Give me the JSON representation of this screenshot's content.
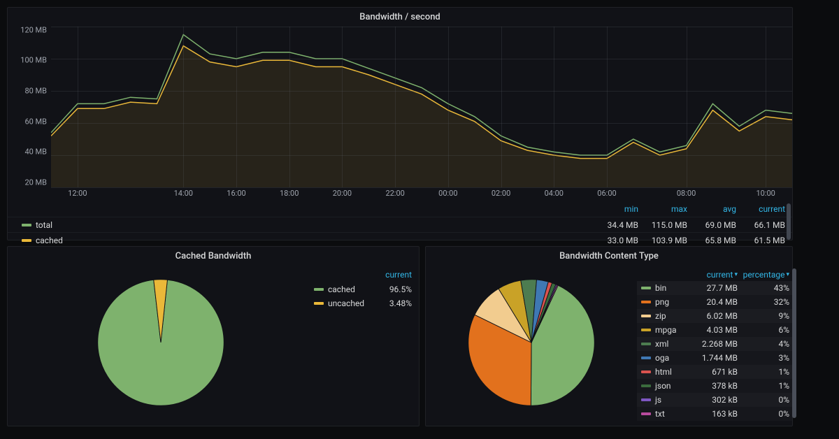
{
  "chart_data": [
    {
      "id": "bandwidth_per_second",
      "type": "line",
      "title": "Bandwidth / second",
      "xlabel": "",
      "ylabel": "",
      "ylim": [
        20,
        120
      ],
      "y_unit": "MB",
      "x": [
        "11:00",
        "12:00",
        "13:00",
        "13:30",
        "13:45",
        "14:00",
        "15:00",
        "16:00",
        "17:00",
        "18:00",
        "19:00",
        "20:00",
        "21:00",
        "22:00",
        "23:00",
        "00:00",
        "01:00",
        "02:00",
        "03:00",
        "04:00",
        "05:00",
        "06:00",
        "06:15",
        "07:00",
        "08:00",
        "08:15",
        "09:00",
        "10:00",
        "10:30"
      ],
      "series": [
        {
          "name": "total",
          "color": "#7eb26d",
          "values": [
            54,
            72,
            72,
            76,
            75,
            115,
            103,
            100,
            104,
            104,
            100,
            100,
            94,
            88,
            82,
            72,
            64,
            52,
            45,
            42,
            40,
            40,
            50,
            42,
            46,
            72,
            58,
            68,
            66
          ]
        },
        {
          "name": "cached",
          "color": "#eab839",
          "values": [
            52,
            69,
            69,
            73,
            72,
            108,
            98,
            95,
            99,
            99,
            95,
            95,
            90,
            84,
            78,
            68,
            61,
            49,
            43,
            40,
            38,
            38,
            48,
            40,
            44,
            68,
            55,
            64,
            62
          ]
        }
      ],
      "yticks": [
        20,
        40,
        60,
        80,
        100,
        120
      ],
      "xticks": [
        "12:00",
        "14:00",
        "16:00",
        "18:00",
        "20:00",
        "22:00",
        "00:00",
        "02:00",
        "04:00",
        "06:00",
        "08:00",
        "10:00"
      ]
    },
    {
      "id": "cached_bandwidth",
      "type": "pie",
      "title": "Cached Bandwidth",
      "series": [
        {
          "name": "cached",
          "value": 96.5,
          "color": "#7eb26d"
        },
        {
          "name": "uncached",
          "value": 3.48,
          "color": "#eab839"
        }
      ]
    },
    {
      "id": "bandwidth_content_type",
      "type": "pie",
      "title": "Bandwidth Content Type",
      "series": [
        {
          "name": "bin",
          "value_label": "27.7 MB",
          "percent": 43,
          "color": "#7eb26d"
        },
        {
          "name": "png",
          "value_label": "20.4 MB",
          "percent": 32,
          "color": "#e2711d"
        },
        {
          "name": "zip",
          "value_label": "6.02 MB",
          "percent": 9,
          "color": "#f2cc8f"
        },
        {
          "name": "mpga",
          "value_label": "4.03 MB",
          "percent": 6,
          "color": "#c9a227"
        },
        {
          "name": "xml",
          "value_label": "2.268 MB",
          "percent": 4,
          "color": "#4d7c50"
        },
        {
          "name": "oga",
          "value_label": "1.744 MB",
          "percent": 3,
          "color": "#3f78b3"
        },
        {
          "name": "html",
          "value_label": "671 kB",
          "percent": 1,
          "color": "#d9534f"
        },
        {
          "name": "json",
          "value_label": "378 kB",
          "percent": 1,
          "color": "#3a6b3d"
        },
        {
          "name": "js",
          "value_label": "302 kB",
          "percent": 0,
          "color": "#7e57c2"
        },
        {
          "name": "txt",
          "value_label": "163 kB",
          "percent": 0,
          "color": "#b84b9e"
        }
      ]
    }
  ],
  "bw_panel": {
    "title": "Bandwidth / second",
    "yticks": [
      "120 MB",
      "100 MB",
      "80 MB",
      "60 MB",
      "40 MB",
      "20 MB"
    ],
    "xticks": [
      "12:00",
      "14:00",
      "16:00",
      "18:00",
      "20:00",
      "22:00",
      "00:00",
      "02:00",
      "04:00",
      "06:00",
      "08:00",
      "10:00"
    ],
    "columns": {
      "min": "min",
      "max": "max",
      "avg": "avg",
      "current": "current"
    },
    "rows": [
      {
        "name": "total",
        "color": "#7eb26d",
        "min": "34.4 MB",
        "max": "115.0 MB",
        "avg": "69.0 MB",
        "current": "66.1 MB"
      },
      {
        "name": "cached",
        "color": "#eab839",
        "min": "33.0 MB",
        "max": "103.9 MB",
        "avg": "65.8 MB",
        "current": "61.5 MB"
      }
    ]
  },
  "cached_panel": {
    "title": "Cached Bandwidth",
    "column_label": "current",
    "rows": [
      {
        "name": "cached",
        "color": "#7eb26d",
        "value": "96.5%"
      },
      {
        "name": "uncached",
        "color": "#eab839",
        "value": "3.48%"
      }
    ]
  },
  "content_panel": {
    "title": "Bandwidth Content Type",
    "columns": {
      "current": "current",
      "percentage": "percentage"
    },
    "rows": [
      {
        "name": "bin",
        "color": "#7eb26d",
        "current": "27.7 MB",
        "pct": "43%"
      },
      {
        "name": "png",
        "color": "#e2711d",
        "current": "20.4 MB",
        "pct": "32%"
      },
      {
        "name": "zip",
        "color": "#f2cc8f",
        "current": "6.02 MB",
        "pct": "9%"
      },
      {
        "name": "mpga",
        "color": "#c9a227",
        "current": "4.03 MB",
        "pct": "6%"
      },
      {
        "name": "xml",
        "color": "#4d7c50",
        "current": "2.268 MB",
        "pct": "4%"
      },
      {
        "name": "oga",
        "color": "#3f78b3",
        "current": "1.744 MB",
        "pct": "3%"
      },
      {
        "name": "html",
        "color": "#d9534f",
        "current": "671 kB",
        "pct": "1%"
      },
      {
        "name": "json",
        "color": "#3a6b3d",
        "current": "378 kB",
        "pct": "1%"
      },
      {
        "name": "js",
        "color": "#7e57c2",
        "current": "302 kB",
        "pct": "0%"
      },
      {
        "name": "txt",
        "color": "#b84b9e",
        "current": "163 kB",
        "pct": "0%"
      }
    ]
  }
}
